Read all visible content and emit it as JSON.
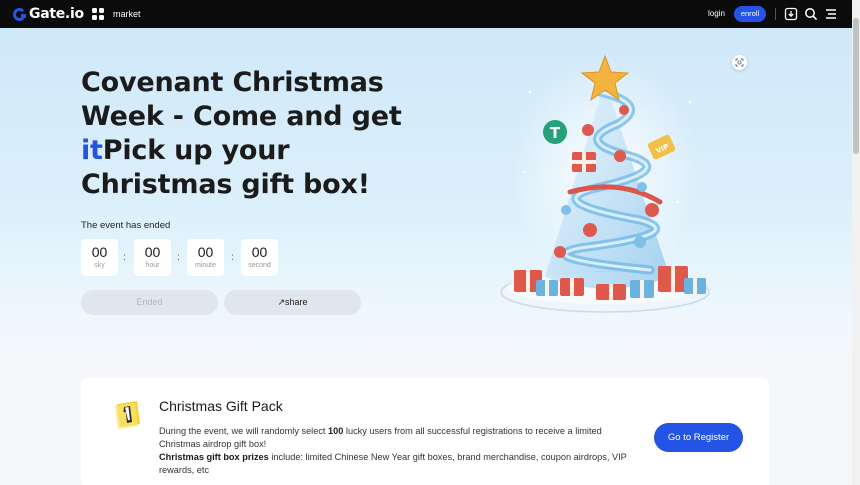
{
  "topbar": {
    "logo_text": "Gate.io",
    "market_label": "market",
    "login_label": "login",
    "enroll_label": "enroll"
  },
  "hero": {
    "title_line_part1": "Covenant Christmas Week - Come and get ",
    "title_accent": "it",
    "title_line_part2": "Pick up your Christmas gift box!",
    "status": "The event has ended",
    "countdown": [
      {
        "value": "00",
        "unit": "sky"
      },
      {
        "value": "00",
        "unit": "hour"
      },
      {
        "value": "00",
        "unit": "minute"
      },
      {
        "value": "00",
        "unit": "second"
      }
    ],
    "ended_label": "Ended",
    "share_label": "↗share"
  },
  "card": {
    "title": "Christmas Gift Pack",
    "desc_1a": "During the event, we will randomly select ",
    "desc_1b": "100",
    "desc_1c": " lucky users from all successful registrations to receive a limited Christmas airdrop gift box!",
    "desc_2a": "Christmas gift box prizes",
    "desc_2b": " include: limited Chinese New Year gift boxes, brand merchandise, coupon airdrops, VIP rewards, etc",
    "register_label": "Go to Register"
  },
  "colors": {
    "accent": "#2354e6",
    "topbar_bg": "#0b0b0b"
  }
}
